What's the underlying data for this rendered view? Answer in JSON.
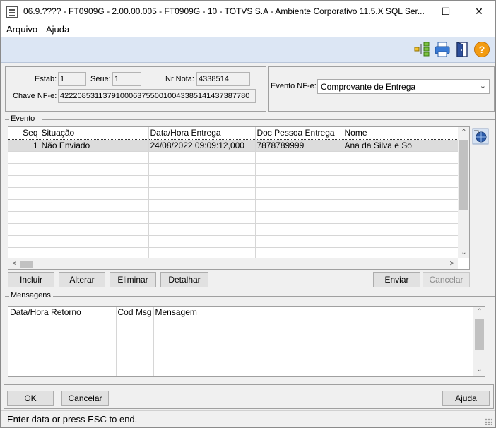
{
  "window": {
    "title": "06.9.???? - FT0909G - 2.00.00.005 - FT0909G - 10 - TOTVS S.A - Ambiente Corporativo 11.5.X SQL Ser..."
  },
  "window_controls": {
    "minimize": "—",
    "maximize": "☐",
    "close": "✕"
  },
  "menu": {
    "arquivo": "Arquivo",
    "ajuda": "Ajuda"
  },
  "toolbar": {
    "icons": [
      "tree-icon",
      "printer-icon",
      "exit-door-icon",
      "help-icon"
    ]
  },
  "header": {
    "estab_label": "Estab:",
    "estab_value": "1",
    "serie_label": "Série:",
    "serie_value": "1",
    "nr_nota_label": "Nr Nota:",
    "nr_nota_value": "4338514",
    "chave_label": "Chave NF-e:",
    "chave_value": "42220853113791000637550010043385141437387780",
    "evento_label": "Evento NF-e:",
    "evento_value": "Comprovante de Entrega"
  },
  "evento": {
    "title": "Evento",
    "columns": [
      "Seq",
      "Situação",
      "Data/Hora Entrega",
      "Doc Pessoa Entrega",
      "Nome"
    ],
    "rows": [
      [
        "1",
        "Não Enviado",
        "24/08/2022 09:09:12,000",
        "7878789999",
        "Ana da Silva e So"
      ]
    ],
    "buttons": {
      "incluir": "Incluir",
      "alterar": "Alterar",
      "eliminar": "Eliminar",
      "detalhar": "Detalhar",
      "enviar": "Enviar",
      "cancelar": "Cancelar"
    }
  },
  "mensagens": {
    "title": "Mensagens",
    "columns": [
      "Data/Hora Retorno",
      "Cod Msg",
      "Mensagem"
    ]
  },
  "footer": {
    "ok": "OK",
    "cancelar": "Cancelar",
    "ajuda": "Ajuda"
  },
  "status": {
    "text": "Enter data or press ESC to end."
  },
  "colors": {
    "toolbar_bg": "#dce6f4",
    "selected_row": "#dcdcdc",
    "window_bg": "#f0f0f0"
  }
}
